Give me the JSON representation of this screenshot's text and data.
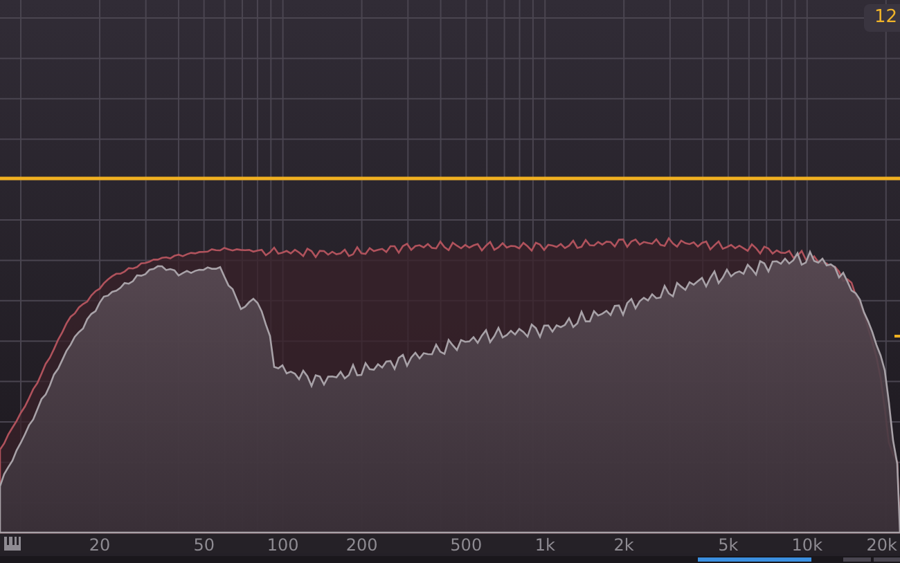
{
  "level_badge": "12",
  "frequency_axis": {
    "labels": [
      "20",
      "50",
      "100",
      "200",
      "500",
      "1k",
      "2k",
      "5k",
      "10k",
      "20k"
    ]
  }
}
